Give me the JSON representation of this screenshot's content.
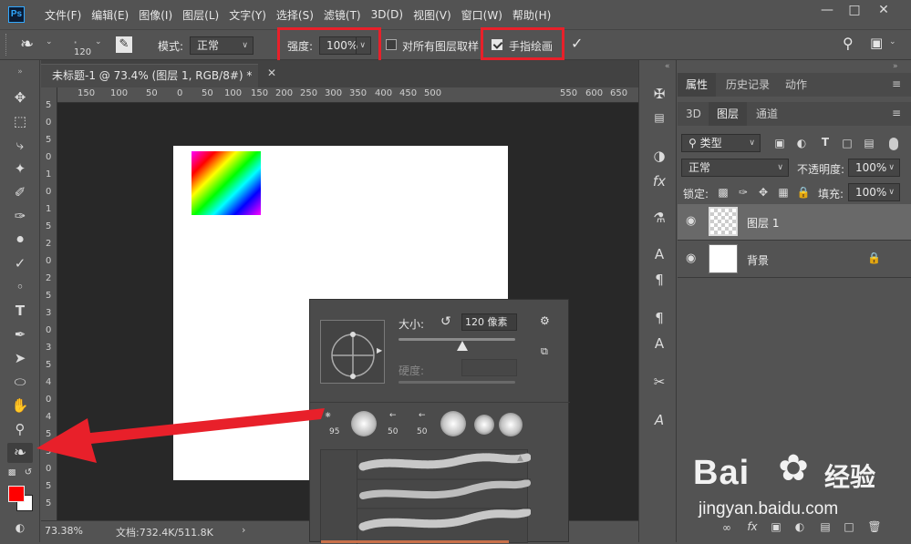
{
  "app": {
    "logo_text": "Ps"
  },
  "menu": [
    "文件(F)",
    "编辑(E)",
    "图像(I)",
    "图层(L)",
    "文字(Y)",
    "选择(S)",
    "滤镜(T)",
    "3D(D)",
    "视图(V)",
    "窗口(W)",
    "帮助(H)"
  ],
  "options": {
    "brush_size": "120",
    "mode_label": "模式:",
    "mode_value": "正常",
    "strength_label": "强度:",
    "strength_value": "100%",
    "sample_all_label": "对所有图层取样",
    "sample_all_checked": false,
    "finger_paint_label": "手指绘画",
    "finger_paint_checked": true
  },
  "document": {
    "tab_title": "未标题-1 @ 73.4% (图层 1, RGB/8#) *",
    "ruler_top": [
      "150",
      "100",
      "50",
      "0",
      "50",
      "100",
      "150",
      "200",
      "250",
      "300",
      "350",
      "400",
      "450",
      "500",
      "550",
      "600",
      "650"
    ],
    "ruler_left": [
      "5",
      "0",
      "5",
      "0",
      "1",
      "0",
      "1",
      "5",
      "2",
      "0",
      "2",
      "5",
      "3",
      "0",
      "3",
      "5",
      "4",
      "0",
      "4",
      "5",
      "5",
      "0",
      "5",
      "5"
    ],
    "zoom": "73.38%",
    "doc_info": "文档:732.4K/511.8K"
  },
  "brush_panel": {
    "size_label": "大小:",
    "size_value": "120 像素",
    "hardness_label": "硬度:",
    "hardness_value": "",
    "presets": [
      "95",
      "",
      "50",
      "50",
      "",
      "",
      ""
    ]
  },
  "panels": {
    "top_tabs": [
      "属性",
      "历史记录",
      "动作"
    ],
    "layer_tabs": [
      "3D",
      "图层",
      "通道"
    ],
    "filter_label": "类型",
    "blend_mode": "正常",
    "opacity_label": "不透明度:",
    "opacity_value": "100%",
    "lock_label": "锁定:",
    "fill_label": "填充:",
    "fill_value": "100%",
    "layers": [
      {
        "name": "图层 1",
        "selected": true,
        "transparent": true,
        "locked": false
      },
      {
        "name": "背景",
        "selected": false,
        "transparent": false,
        "locked": true
      }
    ],
    "bottom_icons": [
      "link-icon",
      "fx-icon",
      "mask-icon",
      "adjustment-icon",
      "folder-icon",
      "new-layer-icon",
      "trash-icon"
    ],
    "bottom_fx_label": "fx"
  },
  "watermark": {
    "brand": "Bai",
    "brand2": "经验",
    "url": "jingyan.baidu.com"
  },
  "colors": {
    "annotation_red": "#e8202a",
    "foreground": "#ff0000",
    "background": "#ffffff"
  }
}
